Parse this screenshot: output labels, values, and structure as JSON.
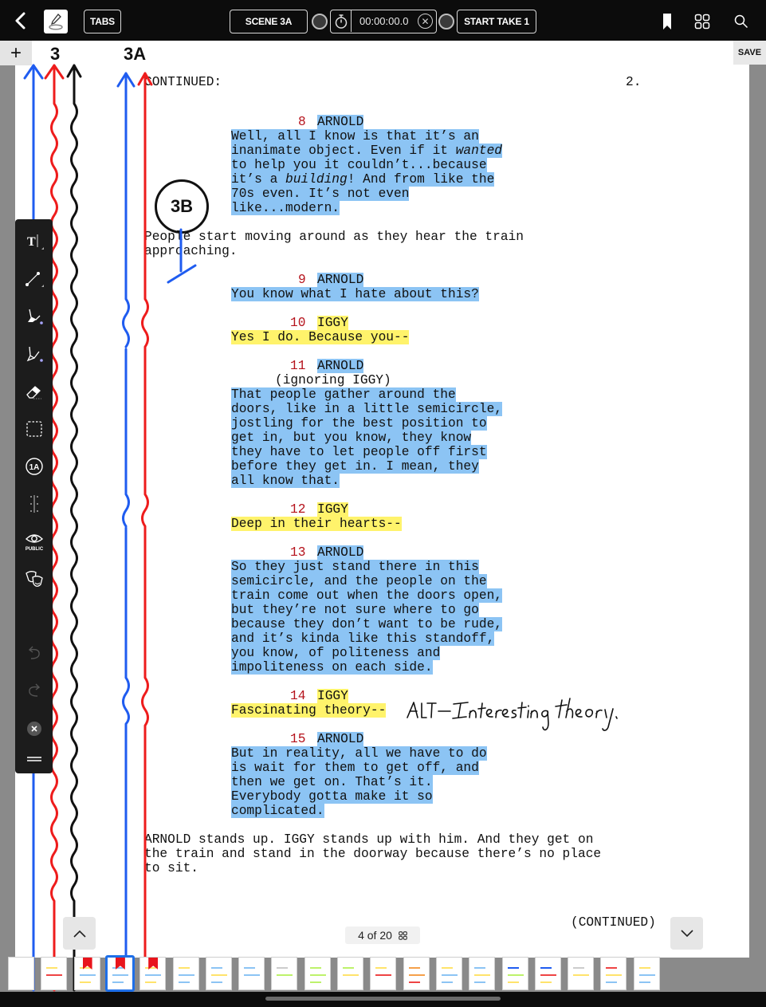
{
  "toolbar": {
    "back_icon": "chevron-left-icon",
    "markup_icon": "pen-signature-icon",
    "tabs_label": "TABS",
    "scene_label": "SCENE 3A",
    "timer_value": "00:00:00.0",
    "timer_clear_icon": "circle-x-icon",
    "take_label": "START TAKE 1",
    "bookmark_icon": "bookmark-icon",
    "grid_icon": "grid-icon",
    "search_icon": "search-icon"
  },
  "page": {
    "add_label": "+",
    "save_label": "SAVE",
    "scene_labels": [
      "3",
      "3A",
      "3B"
    ],
    "header_left": "CONTINUED:",
    "header_right": "2.",
    "footer": "(CONTINUED)",
    "handwritten_note": "ALT–Interesting theory.",
    "blocks": [
      {
        "num": "8",
        "character": "ARNOLD",
        "highlight": "blue",
        "lines": [
          "Well, all I know is that it’s an",
          "inanimate object. Even if it wanted",
          "to help you it couldn’t...because",
          "it’s a building! And from like the",
          "70s even. It’s not even",
          "like...modern."
        ]
      },
      {
        "action": [
          "People start moving around as they hear the train",
          "approaching."
        ]
      },
      {
        "num": "9",
        "character": "ARNOLD",
        "highlight": "blue",
        "lines": [
          "You know what I hate about this?"
        ]
      },
      {
        "num": "10",
        "character": "IGGY",
        "highlight": "yellow",
        "lines": [
          "Yes I do. Because you--"
        ]
      },
      {
        "num": "11",
        "character": "ARNOLD",
        "highlight": "blue",
        "parenthetical": "(ignoring IGGY)",
        "lines": [
          "That people gather around the",
          "doors, like in a little semicircle,",
          "jostling for the best position to",
          "get in, but you know, they know",
          "they have to let people off first",
          "before they get in. I mean, they",
          "all know that."
        ]
      },
      {
        "num": "12",
        "character": "IGGY",
        "highlight": "yellow",
        "lines": [
          "Deep in their hearts--"
        ]
      },
      {
        "num": "13",
        "character": "ARNOLD",
        "highlight": "blue",
        "lines": [
          "So they just stand there in this",
          "semicircle, and the people on the",
          "train come out when the doors open,",
          "but they’re not sure where to go",
          "because they don’t want to be rude,",
          "and it’s kinda like this standoff,",
          "you know, of politeness and",
          "impoliteness on each side."
        ]
      },
      {
        "num": "14",
        "character": "IGGY",
        "highlight": "yellow",
        "lines": [
          "Fascinating theory--"
        ]
      },
      {
        "num": "15",
        "character": "ARNOLD",
        "highlight": "blue",
        "lines": [
          "But in reality, all we have to do",
          "is wait for them to get off, and",
          "then we get on. That’s it.",
          "Everybody gotta make it so",
          "complicated."
        ]
      },
      {
        "action": [
          "ARNOLD stands up. IGGY stands up with him. And they get on",
          "the train and stand in the doorway because there’s no place",
          "to sit."
        ]
      }
    ]
  },
  "palette": {
    "tools": [
      {
        "name": "text-tool",
        "icon": "text-cursor-icon"
      },
      {
        "name": "line-tool",
        "icon": "line-icon"
      },
      {
        "name": "highlighter-tool",
        "icon": "highlighter-icon"
      },
      {
        "name": "pen-tool",
        "icon": "pen-icon"
      },
      {
        "name": "eraser-tool",
        "icon": "eraser-icon"
      },
      {
        "name": "select-tool",
        "icon": "dashed-square-icon"
      },
      {
        "name": "scene-number-tool",
        "icon": "circle-1a-icon",
        "label": "1A"
      },
      {
        "name": "line-break-tool",
        "icon": "vertical-dotted-line-icon"
      },
      {
        "name": "public-toggle",
        "icon": "eye-icon",
        "label": "PUBLIC"
      },
      {
        "name": "masks-tool",
        "icon": "theater-masks-icon"
      },
      {
        "name": "undo",
        "icon": "undo-icon"
      },
      {
        "name": "redo",
        "icon": "redo-icon"
      },
      {
        "name": "close-palette",
        "icon": "close-icon"
      },
      {
        "name": "palette-handle",
        "icon": "drag-handle-icon"
      }
    ]
  },
  "navigation": {
    "page_indicator": "4 of 20",
    "current_page": 4,
    "total_pages": 20,
    "prev_icon": "chevron-up-icon",
    "next_icon": "chevron-down-icon"
  },
  "colors": {
    "highlight_blue": "#8cc4f4",
    "highlight_yellow": "#fff36b",
    "cue_red": "#b5121b",
    "line_blue": "#1f5cf0",
    "line_red": "#ee1c1c",
    "selected_thumb": "#1e6fe8"
  }
}
